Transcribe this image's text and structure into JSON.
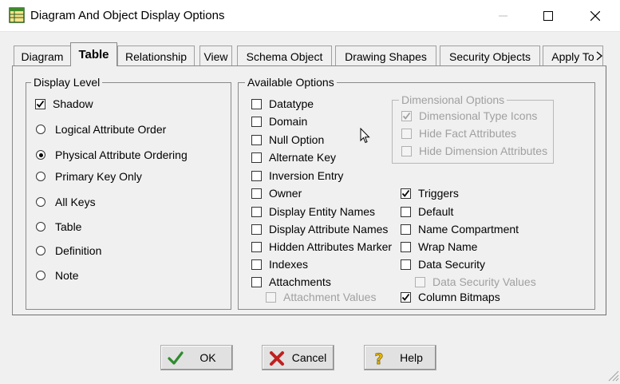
{
  "window": {
    "title": "Diagram And Object Display Options"
  },
  "tabs": [
    {
      "label": "Diagram",
      "active": false
    },
    {
      "label": "Table",
      "active": true
    },
    {
      "label": "Relationship",
      "active": false
    },
    {
      "label": "View",
      "active": false
    },
    {
      "label": "Schema Object",
      "active": false
    },
    {
      "label": "Drawing Shapes",
      "active": false
    },
    {
      "label": "Security Objects",
      "active": false
    },
    {
      "label": "Apply To",
      "active": false
    }
  ],
  "display_level": {
    "title": "Display Level",
    "shadow": {
      "label": "Shadow",
      "checked": true
    },
    "options": [
      {
        "label": "Logical Attribute Order",
        "selected": false
      },
      {
        "label": "Physical Attribute Ordering",
        "selected": true
      },
      {
        "label": "Primary Key Only",
        "selected": false
      },
      {
        "label": "All Keys",
        "selected": false
      },
      {
        "label": "Table",
        "selected": false
      },
      {
        "label": "Definition",
        "selected": false
      },
      {
        "label": "Note",
        "selected": false
      }
    ]
  },
  "available_options": {
    "title": "Available Options",
    "left": [
      {
        "label": "Datatype",
        "checked": false,
        "disabled": false
      },
      {
        "label": "Domain",
        "checked": false,
        "disabled": false
      },
      {
        "label": "Null Option",
        "checked": false,
        "disabled": false
      },
      {
        "label": "Alternate Key",
        "checked": false,
        "disabled": false
      },
      {
        "label": "Inversion Entry",
        "checked": false,
        "disabled": false
      },
      {
        "label": "Owner",
        "checked": false,
        "disabled": false
      },
      {
        "label": "Display Entity Names",
        "checked": false,
        "disabled": false
      },
      {
        "label": "Display Attribute Names",
        "checked": false,
        "disabled": false
      },
      {
        "label": "Hidden Attributes Marker",
        "checked": false,
        "disabled": false
      },
      {
        "label": "Indexes",
        "checked": false,
        "disabled": false
      },
      {
        "label": "Attachments",
        "checked": false,
        "disabled": false
      }
    ],
    "attachment_values": {
      "label": "Attachment Values",
      "checked": false,
      "disabled": true
    },
    "dimensional": {
      "title": "Dimensional Options",
      "items": [
        {
          "label": "Dimensional Type Icons",
          "checked": true,
          "disabled": true
        },
        {
          "label": "Hide Fact Attributes",
          "checked": false,
          "disabled": true
        },
        {
          "label": "Hide Dimension Attributes",
          "checked": false,
          "disabled": true
        }
      ]
    },
    "right": [
      {
        "label": "Triggers",
        "checked": true,
        "disabled": false
      },
      {
        "label": "Default",
        "checked": false,
        "disabled": false
      },
      {
        "label": "Name Compartment",
        "checked": false,
        "disabled": false
      },
      {
        "label": "Wrap Name",
        "checked": false,
        "disabled": false
      },
      {
        "label": "Data Security",
        "checked": false,
        "disabled": false
      }
    ],
    "data_security_values": {
      "label": "Data Security Values",
      "checked": false,
      "disabled": true
    },
    "column_bitmaps": {
      "label": "Column Bitmaps",
      "checked": true,
      "disabled": false
    }
  },
  "buttons": {
    "ok": {
      "label": "OK",
      "icon": "checkmark-icon"
    },
    "cancel": {
      "label": "Cancel",
      "icon": "red-x-icon"
    },
    "help": {
      "label": "Help",
      "icon": "question-mark-icon"
    }
  },
  "colors": {
    "ok_icon": "#2e8b2e",
    "cancel_icon": "#c0201e",
    "help_icon": "#e6b800"
  }
}
